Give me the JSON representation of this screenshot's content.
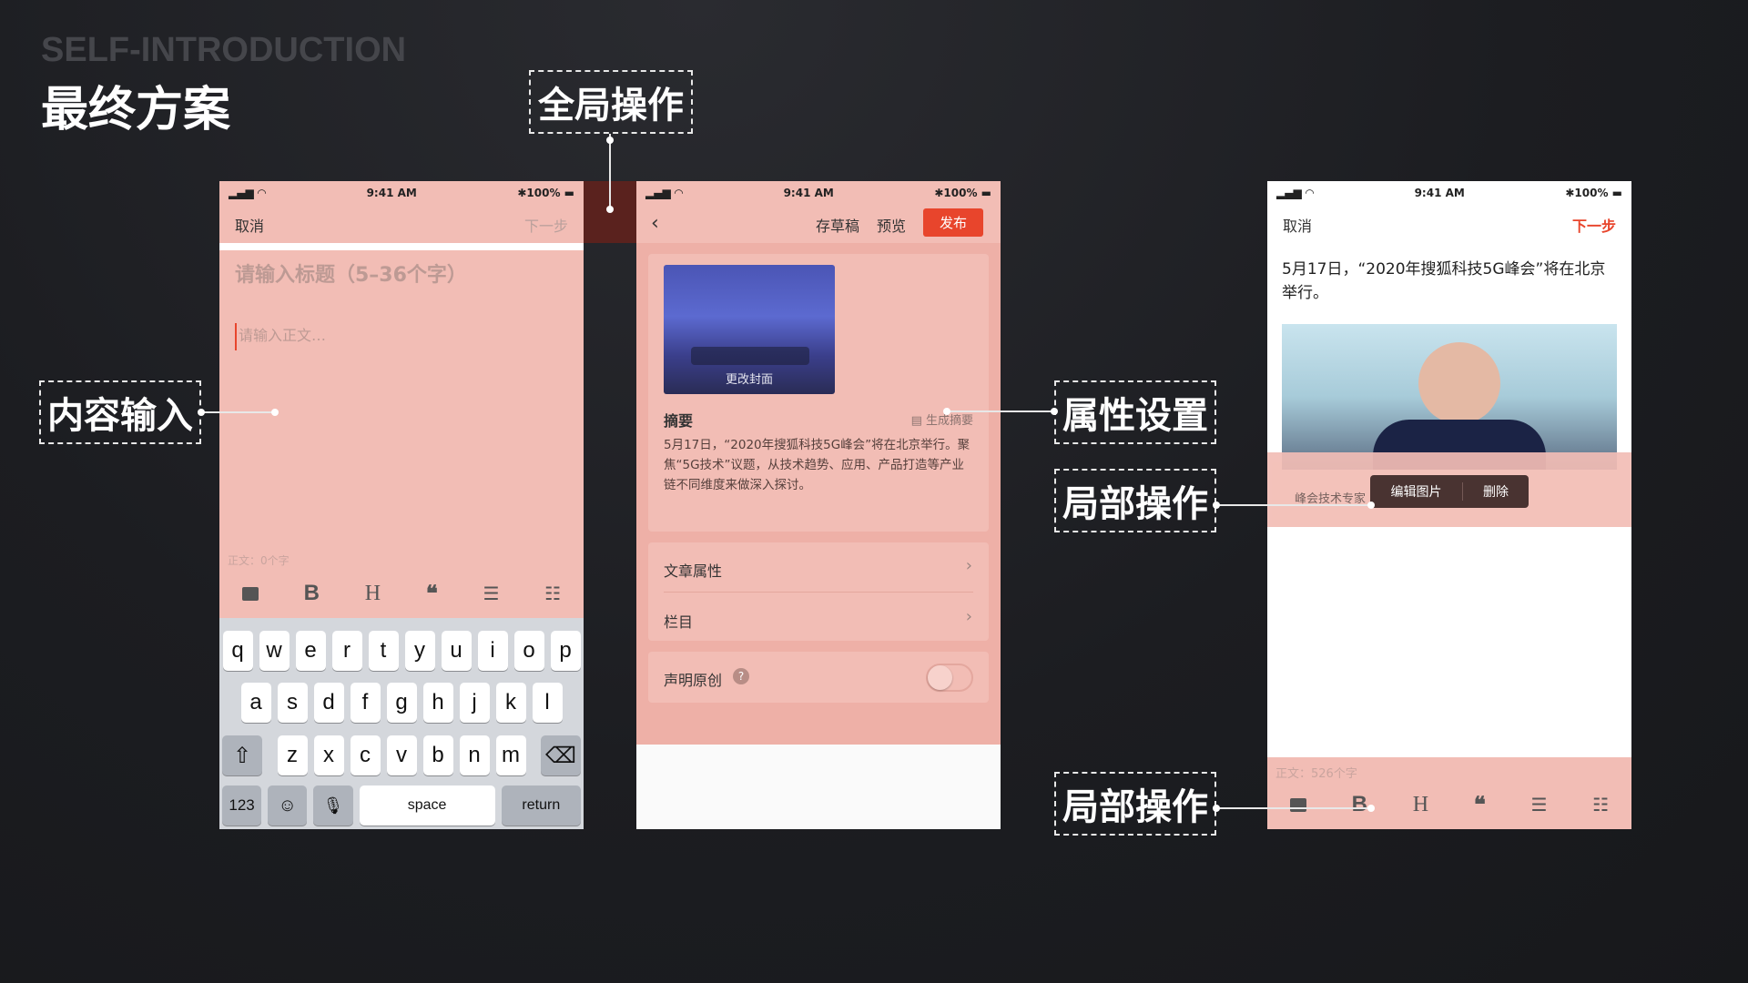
{
  "header": {
    "subtitle": "SELF-INTRODUCTION",
    "title": "最终方案"
  },
  "annotations": {
    "global": "全局操作",
    "content": "内容输入",
    "props": "属性设置",
    "local1": "局部操作",
    "local2": "局部操作"
  },
  "status": {
    "time": "9:41 AM",
    "battery": "100%"
  },
  "screen1": {
    "cancel": "取消",
    "next": "下一步",
    "title_placeholder": "请输入标题（5–36个字）",
    "body_placeholder": "请输入正文…",
    "word_count": "正文：0个字",
    "toolbar": [
      "image-icon",
      "B",
      "H",
      "❝",
      "list-icon",
      "numbered-list-icon"
    ],
    "keys_row1": [
      "q",
      "w",
      "e",
      "r",
      "t",
      "y",
      "u",
      "i",
      "o",
      "p"
    ],
    "keys_row2": [
      "a",
      "s",
      "d",
      "f",
      "g",
      "h",
      "j",
      "k",
      "l"
    ],
    "keys_row3": [
      "z",
      "x",
      "c",
      "v",
      "b",
      "n",
      "m"
    ],
    "key_123": "123",
    "key_space": "space",
    "key_return": "return"
  },
  "screen2": {
    "save_draft": "存草稿",
    "preview": "预览",
    "publish": "发布",
    "change_cover": "更改封面",
    "summary_label": "摘要",
    "gen_summary": "生成摘要",
    "summary_text": "5月17日，“2020年搜狐科技5G峰会”将在北京举行。聚焦“5G技术”议题，从技术趋势、应用、产品打造等产业链不同维度来做深入探讨。",
    "article_props": "文章属性",
    "column": "栏目",
    "declare_original": "声明原创",
    "accent": "#e8452c"
  },
  "screen3": {
    "cancel": "取消",
    "next": "下一步",
    "body_text": "5月17日，“2020年搜狐科技5G峰会”将在北京举行。",
    "caption": "峰会技术专家",
    "edit_image": "编辑图片",
    "delete": "删除",
    "word_count": "正文：526个字"
  }
}
